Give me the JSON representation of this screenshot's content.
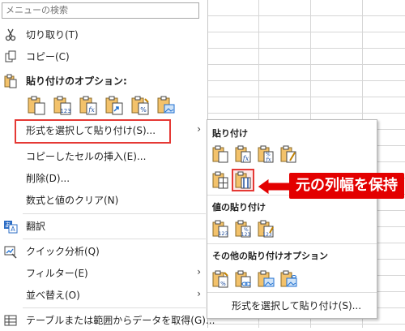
{
  "search": {
    "placeholder": "メニューの検索"
  },
  "menu": {
    "cut": "切り取り(T)",
    "copy": "コピー(C)",
    "paste_options": "貼り付けのオプション:",
    "paste_special": "形式を選択して貼り付け(S)...",
    "insert_copied": "コピーしたセルの挿入(E)...",
    "delete": "削除(D)...",
    "clear": "数式と値のクリア(N)",
    "translate": "翻訳",
    "quick_analysis": "クイック分析(Q)",
    "filter": "フィルター(E)",
    "sort": "並べ替え(O)",
    "table_range": "テーブルまたは範囲からデータを取得(G)..."
  },
  "submenu": {
    "paste_header": "貼り付け",
    "values_header": "値の貼り付け",
    "other_header": "その他の貼り付けオプション",
    "bottom": "形式を選択して貼り付け(S)..."
  },
  "callout": "元の列幅を保持",
  "icons": {
    "paste": [
      "paste-icon",
      "paste-values-icon",
      "paste-formulas-icon",
      "paste-link-icon",
      "paste-formatting-icon",
      "paste-picture-icon"
    ],
    "sub_paste": [
      "paste-icon",
      "paste-formulas-icon",
      "paste-formulas-number-format-icon",
      "paste-keep-source-formatting-icon",
      "paste-no-borders-icon",
      "paste-keep-column-widths-icon"
    ],
    "values": [
      "paste-values-icon",
      "paste-values-number-format-icon",
      "paste-values-source-formatting-icon"
    ],
    "other": [
      "paste-formatting-icon",
      "paste-link-icon",
      "paste-picture-icon",
      "paste-linked-picture-icon"
    ]
  },
  "colors": {
    "accent": "#e53935",
    "callout_bg": "#e30000"
  }
}
